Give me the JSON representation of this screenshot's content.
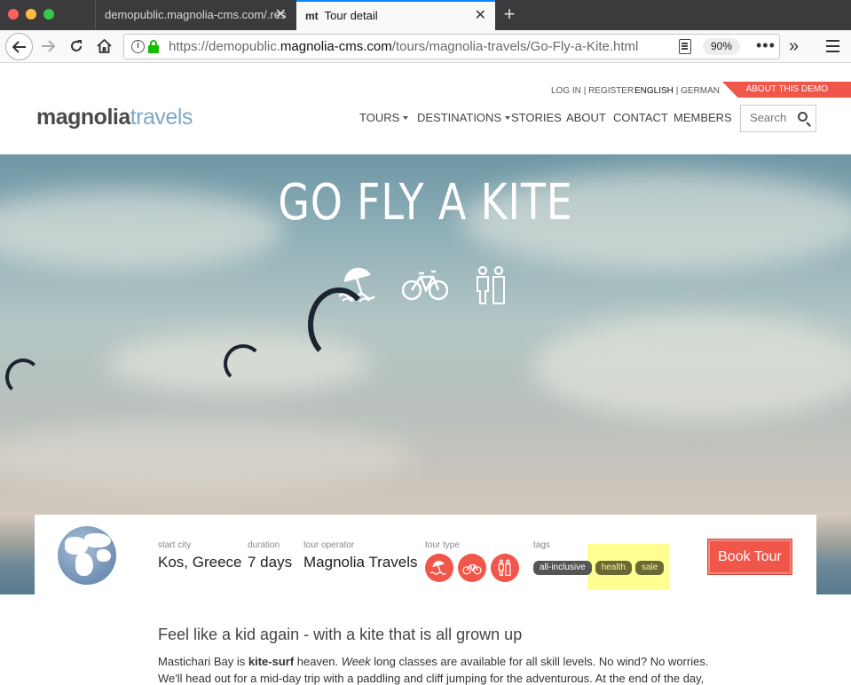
{
  "browser": {
    "tabs": [
      {
        "title": "demopublic.magnolia-cms.com/.res"
      },
      {
        "title": "Tour detail",
        "favicon": "mt"
      }
    ],
    "url_prefix": "https://demopublic.",
    "url_domain": "magnolia-cms.com",
    "url_path": "/tours/magnolia-travels/Go-Fly-a-Kite.html",
    "zoom": "90%",
    "icons": [
      "back-icon",
      "forward-icon",
      "reload-icon",
      "home-icon",
      "info-icon",
      "lock-icon",
      "reader-icon",
      "more-icon",
      "overflow-icon",
      "menu-icon"
    ]
  },
  "site": {
    "toplinks": {
      "login": "LOG IN",
      "register": "REGISTER",
      "lang_active": "ENGLISH",
      "lang_other": "GERMAN",
      "separator": "|"
    },
    "demo_ribbon": "ABOUT THIS DEMO",
    "logo": {
      "part1": "magnolia",
      "part2": "travels"
    },
    "nav": [
      "TOURS",
      "DESTINATIONS",
      "STORIES",
      "ABOUT",
      "CONTACT",
      "MEMBERS"
    ],
    "search_placeholder": "Search"
  },
  "hero": {
    "title": "GO FLY A KITE",
    "icons": [
      "beach-surf-icon",
      "bicycle-icon",
      "family-icon"
    ]
  },
  "tour": {
    "start_city_label": "start city",
    "start_city": "Kos, Greece",
    "duration_label": "duration",
    "duration": "7 days",
    "operator_label": "tour operator",
    "operator": "Magnolia Travels",
    "tour_type_label": "tour type",
    "tags_label": "tags",
    "tags": [
      "all-inclusive",
      "health",
      "sale"
    ],
    "book_label": "Book Tour"
  },
  "content": {
    "heading": "Feel like a kid again - with a kite that is all grown up",
    "para_start": "Mastichari Bay is ",
    "para_bold": "kite-surf",
    "para_mid": " heaven. ",
    "para_italic": "Week",
    "para_end": " long classes are available for all skill levels. No wind? No worries.",
    "para_line2": "We'll head out for a mid-day trip with a paddling and cliff jumping for the adventurous. At the end of the day,"
  },
  "colors": {
    "accent": "#f0564a",
    "tab_active_border": "#0a84ff",
    "logo_blue": "#7fa7c9",
    "highlight": "#ffff7e"
  }
}
